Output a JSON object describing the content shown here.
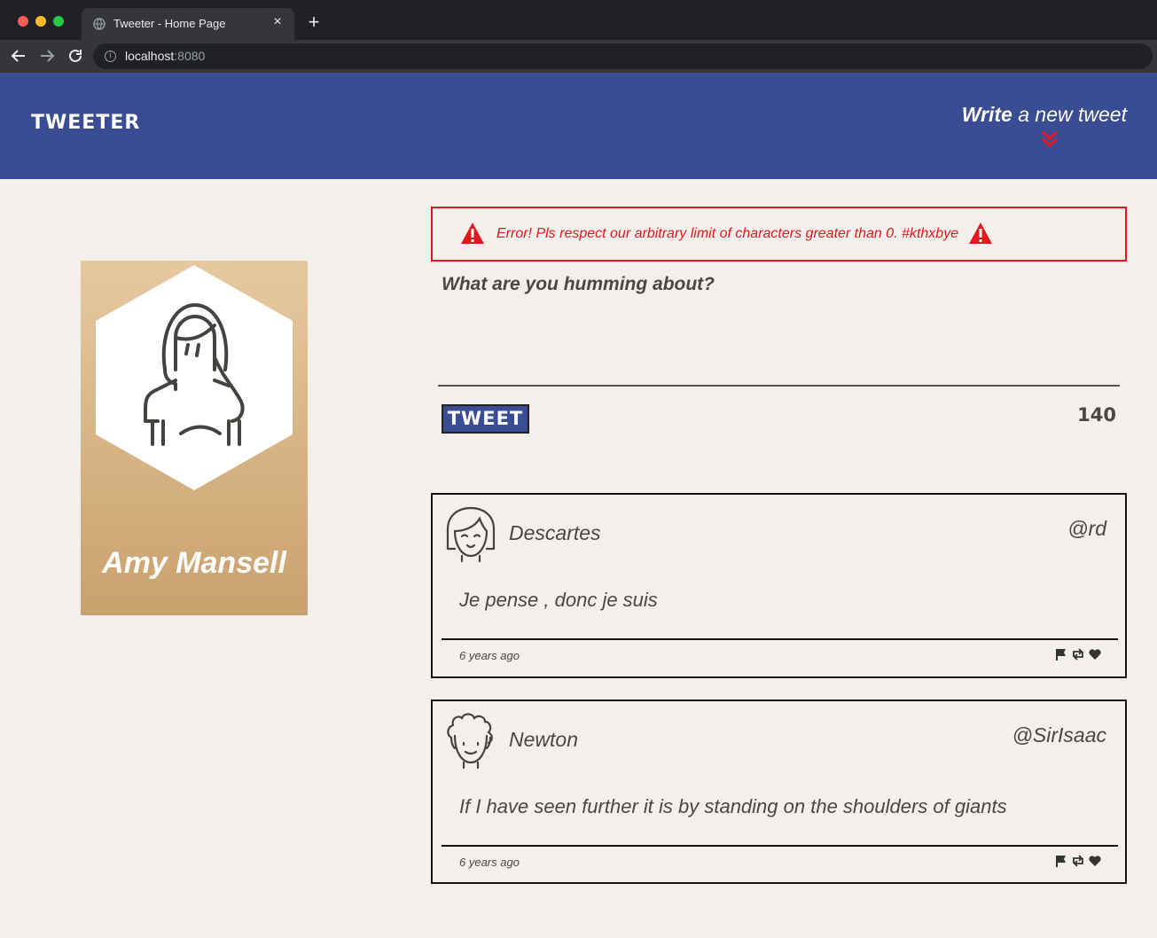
{
  "browser": {
    "tab_title": "Tweeter - Home Page",
    "tab_close": "×",
    "new_tab": "+",
    "url_host": "localhost",
    "url_port": ":8080"
  },
  "header": {
    "brand": "TWEETER",
    "compose_bold": "Write",
    "compose_rest": " a new tweet",
    "accent_color": "#3a4d94",
    "chevron_color": "#e3181e"
  },
  "profile": {
    "name": "Amy Mansell"
  },
  "compose": {
    "error": "Error! Pls respect our arbitrary limit of characters greater than 0. #kthxbye",
    "placeholder": "What are you humming about?",
    "button": "TWEET",
    "counter": "140",
    "error_color": "#e3181e"
  },
  "tweets": [
    {
      "name": "Descartes",
      "handle": "@rd",
      "body": "Je pense , donc je suis",
      "time": "6 years ago",
      "avatar_icon": "girl-face-icon"
    },
    {
      "name": "Newton",
      "handle": "@SirIsaac",
      "body": "If I have seen further it is by standing on the shoulders of giants",
      "time": "6 years ago",
      "avatar_icon": "curly-hair-face-icon"
    }
  ]
}
